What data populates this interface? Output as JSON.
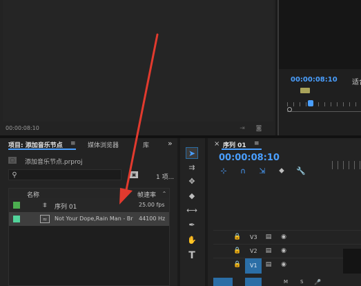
{
  "source_monitor": {
    "timecode": "00:00:08:10"
  },
  "program_monitor": {
    "timecode": "00:00:08:10",
    "fit_label": "适合"
  },
  "project_panel": {
    "tab_project": "项目: 添加音乐节点",
    "tab_menu_glyph": "≡",
    "tab_media_browser": "媒体浏览器",
    "tab_library": "库",
    "overflow_glyph": "»",
    "project_file": "添加音乐节点.prproj",
    "item_count": "1 项...",
    "col_name": "名称",
    "col_framerate": "帧速率",
    "rows": [
      {
        "name": "序列 01",
        "rate": "25.00 fps",
        "color": "#4caf50"
      },
      {
        "name": "Not Your Dope,Rain Man - Br",
        "rate": "44100 Hz",
        "color": "#52d39a"
      }
    ]
  },
  "timeline": {
    "tab_close": "×",
    "sequence_name": "序列 01",
    "menu_glyph": "≡",
    "timecode": "00:00:08:10",
    "tracks": [
      {
        "label": "V3"
      },
      {
        "label": "V2"
      },
      {
        "label": "V1"
      }
    ],
    "audio_buttons": [
      "M",
      "S"
    ]
  },
  "tools": [
    "selection-tool",
    "track-select-tool",
    "ripple-edit-tool",
    "razor-tool",
    "slip-tool",
    "pen-tool",
    "hand-tool",
    "type-tool"
  ],
  "colors": {
    "accent_blue": "#4a9fff",
    "annotation_red": "#e23a2e",
    "track_blue": "#2b6ea6"
  }
}
